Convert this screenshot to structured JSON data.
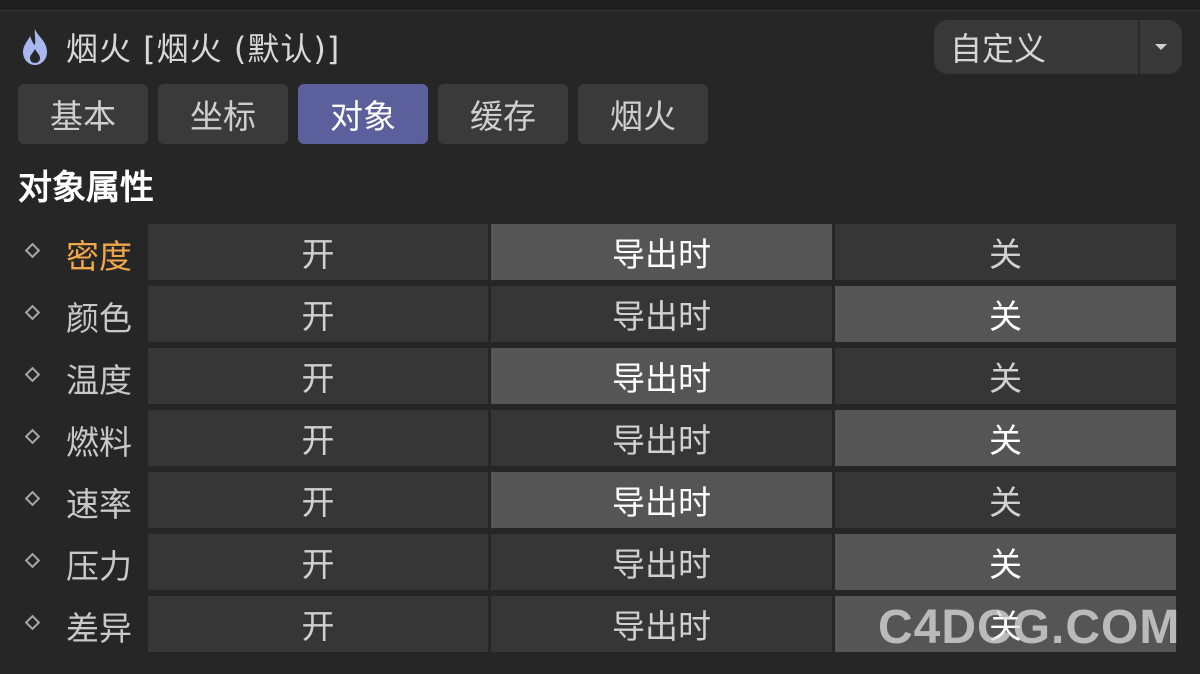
{
  "header": {
    "icon": "flame-icon",
    "title": "烟火 [烟火 (默认)]",
    "preset_label": "自定义",
    "preset_arrow_icon": "caret-down-icon"
  },
  "tabs": [
    {
      "label": "基本",
      "active": false
    },
    {
      "label": "坐标",
      "active": false
    },
    {
      "label": "对象",
      "active": true
    },
    {
      "label": "缓存",
      "active": false
    },
    {
      "label": "烟火",
      "active": false
    }
  ],
  "section_title": "对象属性",
  "options": {
    "on": "开",
    "export": "导出时",
    "off": "关"
  },
  "rows": [
    {
      "label": "密度",
      "selected": "export",
      "highlight": true
    },
    {
      "label": "颜色",
      "selected": "off",
      "highlight": false
    },
    {
      "label": "温度",
      "selected": "export",
      "highlight": false
    },
    {
      "label": "燃料",
      "selected": "off",
      "highlight": false
    },
    {
      "label": "速率",
      "selected": "export",
      "highlight": false
    },
    {
      "label": "压力",
      "selected": "off",
      "highlight": false
    },
    {
      "label": "差异",
      "selected": "off",
      "highlight": false
    }
  ],
  "watermark": "C4DCG.COM",
  "colors": {
    "accent_tab": "#5b5f9c",
    "highlight_label": "#f0a64a",
    "flame_icon": "#a9b9ef"
  }
}
